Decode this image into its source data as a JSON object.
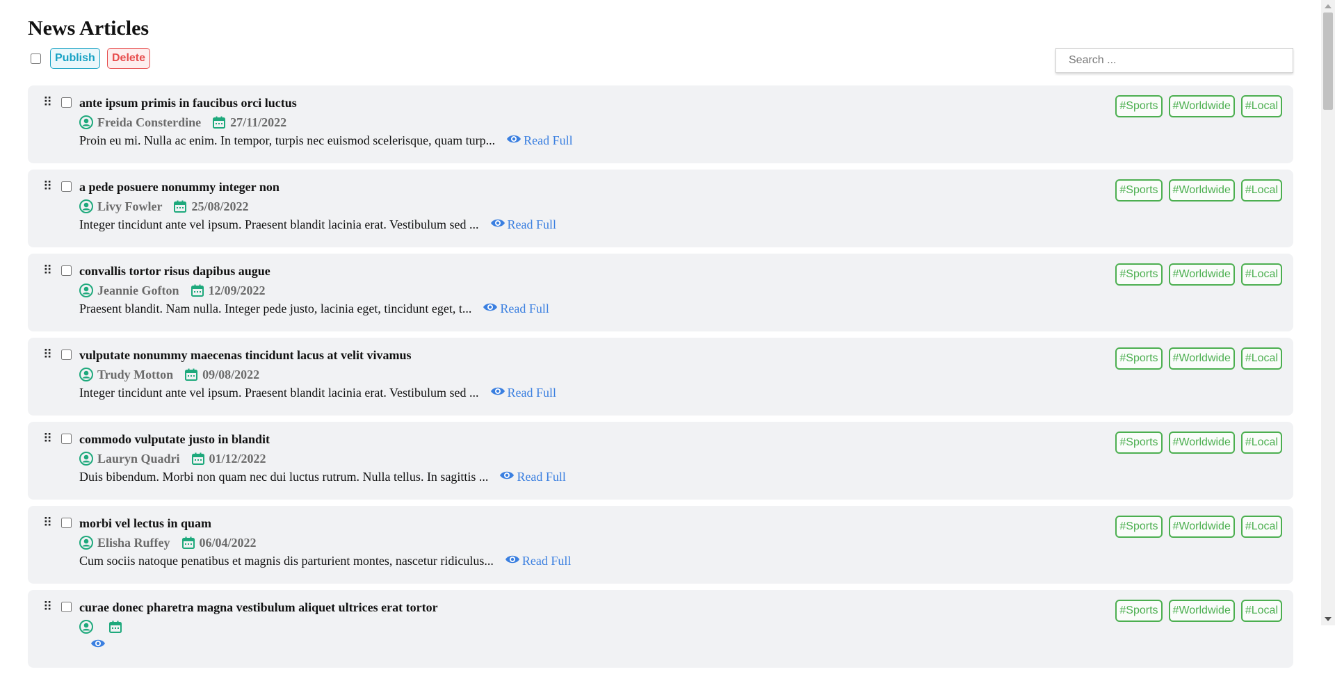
{
  "page": {
    "title": "News Articles"
  },
  "toolbar": {
    "publish_label": "Publish",
    "delete_label": "Delete",
    "search_placeholder": "Search ..."
  },
  "colors": {
    "publish": "#17a2c4",
    "delete": "#e74c4c",
    "tag": "#4caf50",
    "icon": "#1ea97c",
    "read_link": "#3a7fe0"
  },
  "articles": [
    {
      "title": "ante ipsum primis in faucibus orci luctus",
      "author": "Freida Consterdine",
      "date": "27/11/2022",
      "excerpt": "Proin eu mi. Nulla ac enim. In tempor, turpis nec euismod scelerisque, quam turp...",
      "read_label": "Read Full",
      "tags": [
        "#Sports",
        "#Worldwide",
        "#Local"
      ]
    },
    {
      "title": "a pede posuere nonummy integer non",
      "author": "Livy Fowler",
      "date": "25/08/2022",
      "excerpt": "Integer tincidunt ante vel ipsum. Praesent blandit lacinia erat. Vestibulum sed ...",
      "read_label": "Read Full",
      "tags": [
        "#Sports",
        "#Worldwide",
        "#Local"
      ]
    },
    {
      "title": "convallis tortor risus dapibus augue",
      "author": "Jeannie Gofton",
      "date": "12/09/2022",
      "excerpt": "Praesent blandit. Nam nulla. Integer pede justo, lacinia eget, tincidunt eget, t...",
      "read_label": "Read Full",
      "tags": [
        "#Sports",
        "#Worldwide",
        "#Local"
      ]
    },
    {
      "title": "vulputate nonummy maecenas tincidunt lacus at velit vivamus",
      "author": "Trudy Motton",
      "date": "09/08/2022",
      "excerpt": "Integer tincidunt ante vel ipsum. Praesent blandit lacinia erat. Vestibulum sed ...",
      "read_label": "Read Full",
      "tags": [
        "#Sports",
        "#Worldwide",
        "#Local"
      ]
    },
    {
      "title": "commodo vulputate justo in blandit",
      "author": "Lauryn Quadri",
      "date": "01/12/2022",
      "excerpt": "Duis bibendum. Morbi non quam nec dui luctus rutrum. Nulla tellus. In sagittis ...",
      "read_label": "Read Full",
      "tags": [
        "#Sports",
        "#Worldwide",
        "#Local"
      ]
    },
    {
      "title": "morbi vel lectus in quam",
      "author": "Elisha Ruffey",
      "date": "06/04/2022",
      "excerpt": "Cum sociis natoque penatibus et magnis dis parturient montes, nascetur ridiculus...",
      "read_label": "Read Full",
      "tags": [
        "#Sports",
        "#Worldwide",
        "#Local"
      ]
    },
    {
      "title": "curae donec pharetra magna vestibulum aliquet ultrices erat tortor",
      "author": "",
      "date": "",
      "excerpt": "",
      "read_label": "",
      "tags": [
        "#Sports",
        "#Worldwide",
        "#Local"
      ]
    }
  ]
}
